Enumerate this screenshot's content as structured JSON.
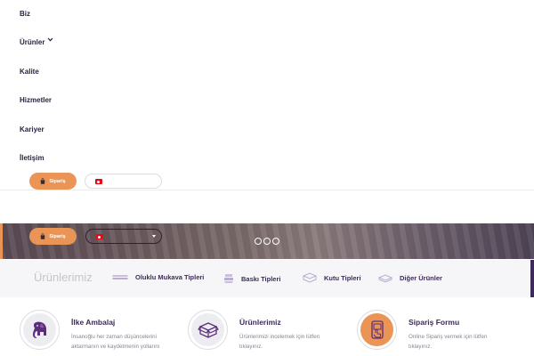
{
  "menu": {
    "items": [
      {
        "label": "Biz"
      },
      {
        "label": "Ürünler",
        "has_submenu": true
      },
      {
        "label": "Kalite"
      },
      {
        "label": "Hizmetler"
      },
      {
        "label": "Kariyer"
      },
      {
        "label": "İletişim"
      }
    ],
    "order_button": "Sipariş"
  },
  "hero": {
    "order_button": "Sipariş",
    "slides_count": 3
  },
  "products": {
    "title": "Ürünlerimiz",
    "categories": [
      {
        "label": "Oluklu Mukava Tipleri",
        "icon": "corrugated-sheet-icon"
      },
      {
        "label": "Baskı Tipleri",
        "icon": "print-stack-icon"
      },
      {
        "label": "Kutu Tipleri",
        "icon": "box-type-icon"
      },
      {
        "label": "Diğer Ürünler",
        "icon": "other-products-icon"
      }
    ]
  },
  "features": [
    {
      "title": "İlke Ambalaj",
      "text": "İnsanoğlu her zaman düşüncelerini aktarmanın ve kaydetmenin yollarını",
      "icon": "elephant-icon"
    },
    {
      "title": "Ürünlerimiz",
      "text": "Ürünlerimizi incelemek için lütfen tıklayınız.",
      "icon": "open-box-icon"
    },
    {
      "title": "Sipariş Formu",
      "text": "Online Sipariş vermek için lütfen tıklayınız.",
      "icon": "mobile-order-icon"
    }
  ],
  "colors": {
    "accent": "#ea9455",
    "brand": "#3d2a5a",
    "flag": "#e30a17"
  }
}
